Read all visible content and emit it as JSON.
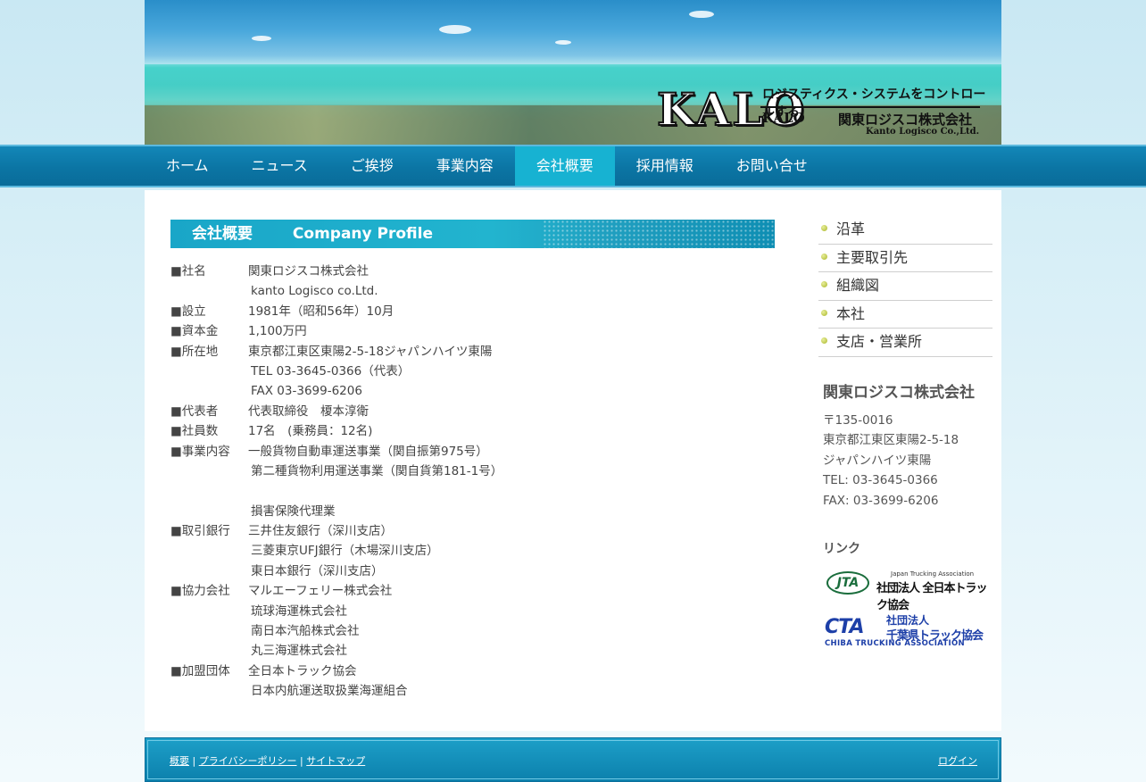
{
  "header": {
    "logo_mark": "KALO",
    "logo_tagline": "ロジスティクス・システムをコントロールする",
    "logo_brand": "KALO",
    "logo_company_jp": "関東ロジスコ株式会社",
    "logo_company_en": "Kanto Logisco Co.,Ltd."
  },
  "nav": {
    "items": [
      {
        "label": "ホーム"
      },
      {
        "label": "ニュース"
      },
      {
        "label": "ご挨拶"
      },
      {
        "label": "事業内容"
      },
      {
        "label": "会社概要",
        "active": true
      },
      {
        "label": "採用情報"
      },
      {
        "label": "お問い合せ"
      }
    ]
  },
  "main": {
    "title_jp": "会社概要",
    "title_en": "Company Profile",
    "profile": [
      {
        "key": "■社名",
        "values": [
          "関東ロジスコ株式会社",
          "kanto Logisco co.Ltd."
        ]
      },
      {
        "key": "■設立",
        "values": [
          "1981年（昭和56年）10月"
        ]
      },
      {
        "key": "■資本金",
        "values": [
          "1,100万円"
        ]
      },
      {
        "key": "■所在地",
        "values": [
          "東京都江東区東陽2-5-18ジャパンハイツ東陽",
          "TEL 03-3645-0366（代表）",
          "FAX 03-3699-6206"
        ]
      },
      {
        "key": "■代表者",
        "values": [
          "代表取締役　榎本淳衛"
        ]
      },
      {
        "key": "■社員数",
        "values": [
          "17名　(乗務員：12名)"
        ]
      },
      {
        "key": "■事業内容",
        "values": [
          "一般貨物自動車運送事業（関自振第975号）",
          "第二種貨物利用運送事業（関自貨第181-1号）",
          "",
          "損害保険代理業"
        ]
      },
      {
        "key": "■取引銀行",
        "values": [
          "三井住友銀行（深川支店）",
          "三菱東京UFJ銀行（木場深川支店）",
          "東日本銀行（深川支店）"
        ]
      },
      {
        "key": "■協力会社",
        "values": [
          "マルエーフェリー株式会社",
          "琉球海運株式会社",
          "南日本汽船株式会社",
          "丸三海運株式会社"
        ]
      },
      {
        "key": "■加盟団体",
        "values": [
          "全日本トラック協会",
          "日本内航運送取扱業海運組合"
        ]
      }
    ]
  },
  "sidebar": {
    "menu": [
      {
        "label": "沿革"
      },
      {
        "label": "主要取引先"
      },
      {
        "label": "組織図"
      },
      {
        "label": "本社"
      },
      {
        "label": "支店・営業所"
      }
    ],
    "company": {
      "name": "関東ロジスコ株式会社",
      "postal": "〒135-0016",
      "address1": "東京都江東区東陽2-5-18",
      "address2": "ジャパンハイツ東陽",
      "tel": "TEL: 03-3645-0366",
      "fax": "FAX: 03-3699-6206"
    },
    "links_title": "リンク",
    "link_banners": [
      {
        "mark": "JTA",
        "en": "Japan Trucking Association",
        "jp": "社団法人 全日本トラック協会"
      },
      {
        "mark": "CTA",
        "jp_top": "社団法人",
        "jp": "千葉県トラック協会",
        "en": "CHIBA TRUCKING ASSOCIATION"
      }
    ]
  },
  "footer": {
    "links": [
      "概要",
      "プライバシーポリシー",
      "サイトマップ"
    ],
    "separator": "|",
    "login": "ログイン"
  }
}
